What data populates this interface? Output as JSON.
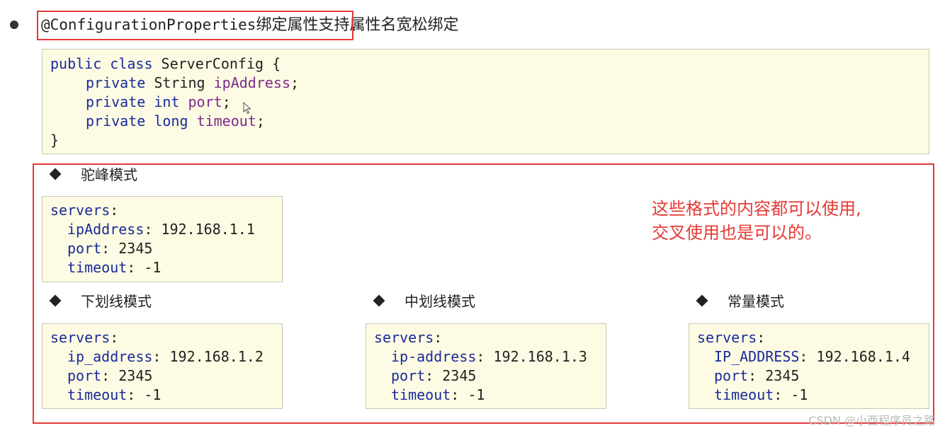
{
  "heading": {
    "annotation": "@ConfigurationProperties",
    "highlighted_text": "绑定属性",
    "rest": "支持属性名宽松绑定"
  },
  "class_code": {
    "line1": {
      "kw": "public class",
      "name": "ServerConfig {"
    },
    "fields": [
      {
        "mod": "private",
        "type": "String",
        "name": "ipAddress",
        "end": ";"
      },
      {
        "mod": "private",
        "type": "int",
        "name": "port",
        "end": ";"
      },
      {
        "mod": "private",
        "type": "long",
        "name": "timeout",
        "end": ";"
      }
    ],
    "close": "}"
  },
  "modes": [
    {
      "title": "驼峰模式",
      "root": "servers",
      "entries": [
        {
          "key": "ipAddress",
          "value": "192.168.1.1"
        },
        {
          "key": "port",
          "value": "2345"
        },
        {
          "key": "timeout",
          "value": "-1"
        }
      ]
    },
    {
      "title": "下划线模式",
      "root": "servers",
      "entries": [
        {
          "key": "ip_address",
          "value": "192.168.1.2"
        },
        {
          "key": "port",
          "value": "2345"
        },
        {
          "key": "timeout",
          "value": "-1"
        }
      ]
    },
    {
      "title": "中划线模式",
      "root": "servers",
      "entries": [
        {
          "key": "ip-address",
          "value": "192.168.1.3"
        },
        {
          "key": "port",
          "value": "2345"
        },
        {
          "key": "timeout",
          "value": "-1"
        }
      ]
    },
    {
      "title": "常量模式",
      "root": "servers",
      "entries": [
        {
          "key": "IP_ADDRESS",
          "value": "192.168.1.4"
        },
        {
          "key": "port",
          "value": "2345"
        },
        {
          "key": "timeout",
          "value": "-1"
        }
      ]
    }
  ],
  "note": {
    "line1": "这些格式的内容都可以使用,",
    "line2": "交叉使用也是可以的。"
  },
  "watermark": "CSDN @小西程序员之路",
  "colors": {
    "highlight_border": "#e53935",
    "note_text": "#e53935",
    "code_background": "#fdfbe3"
  },
  "icons": {
    "bullet": "bullet-dot-icon",
    "section_marker": "diamond-icon",
    "cursor": "mouse-pointer-icon"
  }
}
